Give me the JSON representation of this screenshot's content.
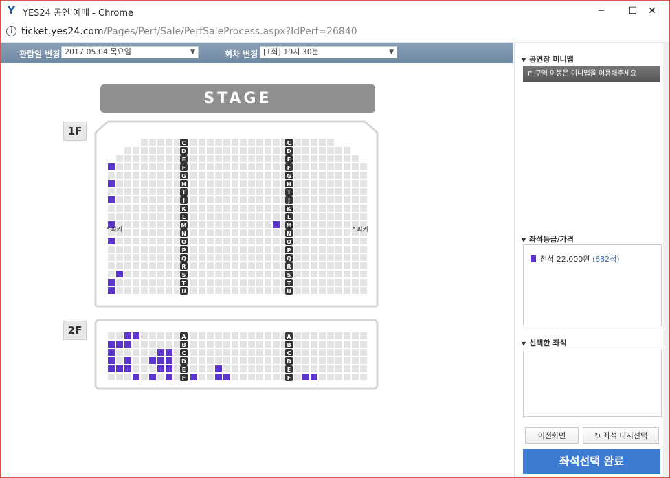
{
  "window": {
    "title": "YES24 공연 예매 - Chrome",
    "logo": "Y",
    "minimize": "─",
    "maximize": "☐",
    "close": "✕"
  },
  "address": {
    "host": "ticket.yes24.com",
    "path": "/Pages/Perf/Sale/PerfSaleProcess.aspx?IdPerf=26840"
  },
  "toolbar": {
    "date_label": "관람일 변경",
    "date_value": "2017.05.04 목요일",
    "session_label": "회차 변경",
    "session_value": "[1회] 19시 30분"
  },
  "stage_label": "STAGE",
  "floors": {
    "f1": {
      "label": "1F",
      "speaker": "스피커",
      "left_rows": [
        "C",
        "D",
        "E",
        "F",
        "G",
        "H",
        "I",
        "J",
        "K",
        "L",
        "M",
        "N",
        "O",
        "P",
        "Q",
        "R",
        "S",
        "T",
        "U"
      ],
      "right_rows": [
        "C",
        "D",
        "E",
        "F",
        "G",
        "H",
        "I",
        "J",
        "K",
        "L",
        "M",
        "N",
        "O",
        "P",
        "Q",
        "R",
        "S",
        "T",
        "U"
      ]
    },
    "f2": {
      "label": "2F",
      "left_rows": [
        "A",
        "B",
        "C",
        "D",
        "E",
        "F"
      ],
      "right_rows": [
        "A",
        "B",
        "C",
        "D",
        "E",
        "F"
      ]
    }
  },
  "seat_colors": {
    "available": "#5c35cc",
    "sold": "#e4e4e4",
    "row_label_bg": "#333333"
  },
  "sidebar": {
    "minimap_title": "공연장 미니맵",
    "minimap_hint": "↱ 구역 이동은 미니맵을 이용해주세요",
    "grade_title": "좌석등급/가격",
    "grade_name": "전석",
    "grade_price": "22,000원",
    "grade_count": "(682석)",
    "selected_title": "선택한 좌석",
    "prev_button": "이전화면",
    "reset_button": "↻ 좌석 다시선택",
    "complete_button": "좌석선택 완료"
  }
}
